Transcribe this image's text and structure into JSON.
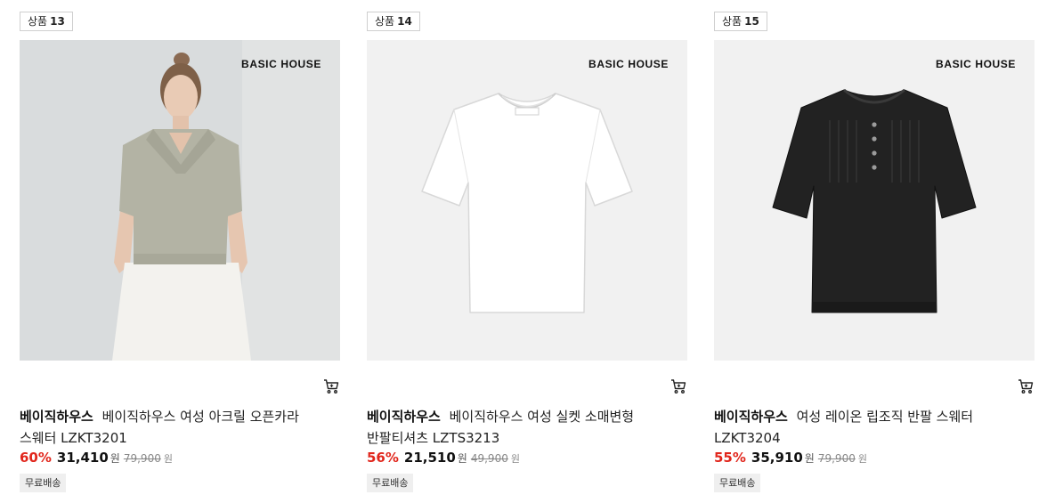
{
  "products": [
    {
      "badge_prefix": "상품",
      "badge_number": "13",
      "brand_mark": "BASIC HOUSE",
      "brand": "베이직하우스",
      "name": "베이직하우스 여성 아크릴 오픈카라 스웨터 LZKT3201",
      "discount": "60%",
      "price": "31,410",
      "currency": "원",
      "original_price": "79,900",
      "original_currency": "원",
      "shipping": "무료배송",
      "garment_color": "#b3b3a4"
    },
    {
      "badge_prefix": "상품",
      "badge_number": "14",
      "brand_mark": "BASIC HOUSE",
      "brand": "베이직하우스",
      "name": "베이직하우스 여성 실켓 소매변형 반팔티셔츠 LZTS3213",
      "discount": "56%",
      "price": "21,510",
      "currency": "원",
      "original_price": "49,900",
      "original_currency": "원",
      "shipping": "무료배송",
      "garment_color": "#ffffff"
    },
    {
      "badge_prefix": "상품",
      "badge_number": "15",
      "brand_mark": "BASIC HOUSE",
      "brand": "베이직하우스",
      "name": "여성 레이온 립조직 반팔 스웨터 LZKT3204",
      "discount": "55%",
      "price": "35,910",
      "currency": "원",
      "original_price": "79,900",
      "original_currency": "원",
      "shipping": "무료배송",
      "garment_color": "#222222"
    }
  ],
  "icons": {
    "cart": "cart-icon"
  }
}
